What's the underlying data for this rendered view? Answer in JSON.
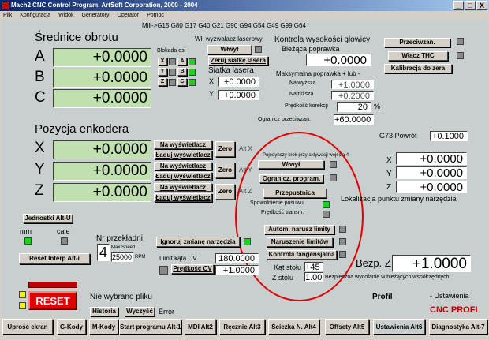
{
  "window": {
    "title": "Mach2 CNC Control Program. ArtSoft Corporation, 2000 - 2004",
    "buttons": [
      "_",
      "□",
      "X"
    ]
  },
  "menu": [
    "Plik",
    "Konfiguracja",
    "Widok",
    "Generatory",
    "Operator",
    "Pomoc"
  ],
  "gcodes": "Mill->G15  G80 G17 G40 G21 G90 G94 G54 G49 G99 G64",
  "spindle": {
    "title": "Średnice obrotu",
    "axes": [
      {
        "name": "A",
        "value": "+0.0000"
      },
      {
        "name": "B",
        "value": "+0.0000"
      },
      {
        "name": "C",
        "value": "+0.0000"
      }
    ]
  },
  "axis_lock": {
    "title": "Blokada osi",
    "items": [
      {
        "left": "X",
        "right": "A"
      },
      {
        "left": "Y",
        "right": "B"
      },
      {
        "left": "Z",
        "right": "C"
      }
    ]
  },
  "laser": {
    "toggle_label": "Wł. wyzwalacz laserowy",
    "on_btn": "Włwył",
    "reset_grid": "Zeruj siatkę lasera",
    "grid_title": "Siatka lasera",
    "x_label": "X",
    "x_value": "+0.0000",
    "y_label": "Y",
    "y_value": "+0.0000"
  },
  "height": {
    "title": "Kontrola wysokości głowicy",
    "current_label": "Bieżąca poprawka",
    "current_value": "+0.0000",
    "max_title": "Maksymalna poprawka + lub -",
    "highest_label": "Najwyższa",
    "highest_value": "+1.0000",
    "lowest_label": "Najniższa",
    "lowest_value": "+0.2000",
    "speed_label": "Prędkość korekcji",
    "speed_value": "20",
    "speed_unit": "%",
    "limit_label": "Ogranicz przeciwzan.",
    "limit_value": "+60.0000"
  },
  "right_buttons": {
    "przeciw": "Przeciwzan.",
    "thc": "Włącz THC",
    "calib": "Kalibracja do zera"
  },
  "encoder": {
    "title": "Pozycja enkodera",
    "axes": [
      {
        "name": "X",
        "value": "+0.0000",
        "alt": "Alt X"
      },
      {
        "name": "Y",
        "value": "+0.0000",
        "alt": "Alt Y"
      },
      {
        "name": "Z",
        "value": "+0.0000",
        "alt": "Alt Z"
      }
    ],
    "to_display": "Na wyświetlacz",
    "load_display": "Ładuj wyświetlacz",
    "zero": "Zero"
  },
  "center": {
    "step_label": "Pojedynczy krok przy aktywacji wejścia 4",
    "onoff": "Włwył",
    "limit_prog": "Ogranicz. program.",
    "pass": "Przepustnica",
    "slow_label": "Spowolnienie posuwu",
    "speed_trans": "Prędkość transm.",
    "auto_limits": "Autom. narusz limity",
    "break_limits": "Naruszenie limitów",
    "tangent": "Kontrola tangensjalna",
    "angle_label": "Kąt stołu",
    "angle_value": "+45",
    "z_label": "Z stołu",
    "z_value": "1.00"
  },
  "g73": {
    "label": "G73 Powrót",
    "value": "+0.1000",
    "x": "+0.0000",
    "y": "+0.0000",
    "z": "+0.0000",
    "tool_change": "Lokalizacja punktu zmiany narzędzia"
  },
  "left": {
    "jog": "Jednostki Alt-U",
    "mm": "mm",
    "cale": "cale",
    "reset_interp": "Reset Interp Alt-i"
  },
  "feed": {
    "title": "Nr przekładni",
    "gear": "4",
    "max_speed_label": "Max Speed",
    "max_speed": "25000",
    "rpm": "RPM"
  },
  "tool": {
    "ignore": "Ignoruj zmianę narzędzia",
    "cv_label": "Limit kąta CV",
    "cv_value": "180.0000",
    "speed_cv": "Prędkość CV",
    "speed_cv_value": "+1.0000"
  },
  "depth": {
    "label": "Bezp. Z",
    "value": "+1.0000",
    "note": "Bezpieczna wycofanie w bieżących współrzędnych"
  },
  "status": {
    "reset": "RESET",
    "no_file": "Nie wybrano pliku",
    "history": "Historia",
    "clear": "Wyczyść",
    "error": "Error",
    "profile_label": "Profil",
    "profile_value": "- Ustawienia",
    "brand": "CNC PROFI"
  },
  "tabs": [
    "Uprość ekran",
    "G-Kody",
    "M-Kody",
    "Start programu Alt-1",
    "MDI Alt2",
    "Ręcznie Alt3",
    "Ścieżka N. Alt4",
    "Offsety Alt5",
    "Ustawienia Alt6",
    "Diagnostyka Alt-7"
  ],
  "colors": {
    "lcd": "#c0e0b0",
    "annotation": "#e00000",
    "brand": "#c00000"
  }
}
